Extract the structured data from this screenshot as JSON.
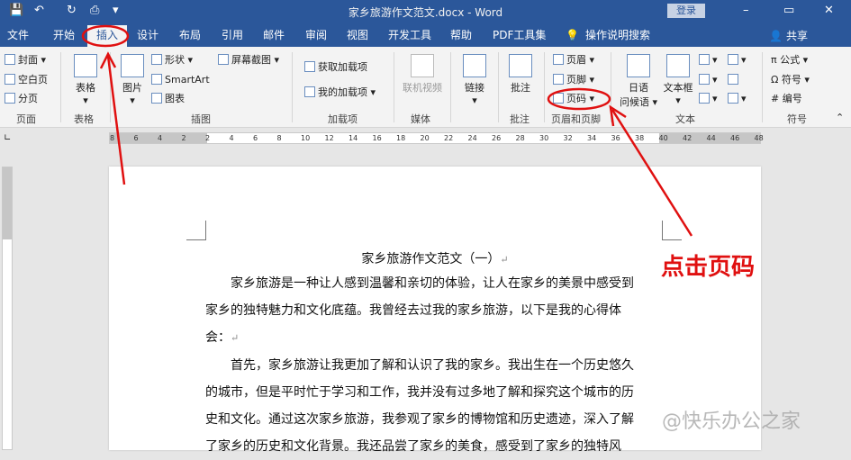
{
  "titlebar": {
    "title": "家乡旅游作文范文.docx - Word",
    "login": "登录",
    "minimize": "–",
    "restore": "▭",
    "close": "✕"
  },
  "menu": {
    "tabs": [
      "文件",
      "开始",
      "插入",
      "设计",
      "布局",
      "引用",
      "邮件",
      "审阅",
      "视图",
      "开发工具",
      "帮助",
      "PDF工具集",
      "操作说明搜索"
    ],
    "active_tab": "插入",
    "share": "共享"
  },
  "ribbon": {
    "pages": {
      "label": "页面",
      "items": [
        "封面",
        "空白页",
        "分页"
      ]
    },
    "tables": {
      "label": "表格",
      "button": "表格"
    },
    "illustrations": {
      "label": "插图",
      "picture": "图片",
      "shapes": "形状",
      "smartart": "SmartArt",
      "chart": "图表",
      "screenshot": "屏幕截图"
    },
    "addins": {
      "label": "加载项",
      "get": "获取加载项",
      "mine": "我的加载项"
    },
    "media": {
      "label": "媒体",
      "video": "联机视频"
    },
    "links": {
      "label": "",
      "button": "链接"
    },
    "comments": {
      "label": "批注",
      "button": "批注"
    },
    "header_footer": {
      "label": "页眉和页脚",
      "header": "页眉",
      "footer": "页脚",
      "page_number": "页码"
    },
    "text": {
      "label": "文本",
      "japanese": "日语",
      "greeting": "问候语",
      "textbox": "文本框"
    },
    "symbols": {
      "label": "符号",
      "equation": "公式",
      "symbol": "符号",
      "number": "编号"
    }
  },
  "ruler": {
    "numbers": [
      "8",
      "6",
      "4",
      "2",
      "2",
      "4",
      "6",
      "8",
      "10",
      "12",
      "14",
      "16",
      "18",
      "20",
      "22",
      "24",
      "26",
      "28",
      "30",
      "32",
      "34",
      "36",
      "38",
      "40",
      "42",
      "44",
      "46",
      "48"
    ]
  },
  "document": {
    "title": "家乡旅游作文范文（一）",
    "paragraphs": [
      [
        "　　家乡旅游是一种让人感到温馨和亲切的体验，让人在家乡的美景中感受到",
        "家乡的独特魅力和文化底蕴。我曾经去过我的家乡旅游，以下是我的心得体",
        "会："
      ],
      [
        "　　首先，家乡旅游让我更加了解和认识了我的家乡。我出生在一个历史悠久",
        "的城市，但是平时忙于学习和工作，我并没有过多地了解和探究这个城市的历",
        "史和文化。通过这次家乡旅游，我参观了家乡的博物馆和历史遗迹，深入了解",
        "了家乡的历史和文化背景。我还品尝了家乡的美食，感受到了家乡的独特风"
      ]
    ],
    "para_mark": "↵"
  },
  "annotation": {
    "text": "点击页码",
    "color": "#e01010"
  },
  "watermark": "@快乐办公之家",
  "colors": {
    "accent": "#2b579a",
    "annotation": "#e01010"
  }
}
